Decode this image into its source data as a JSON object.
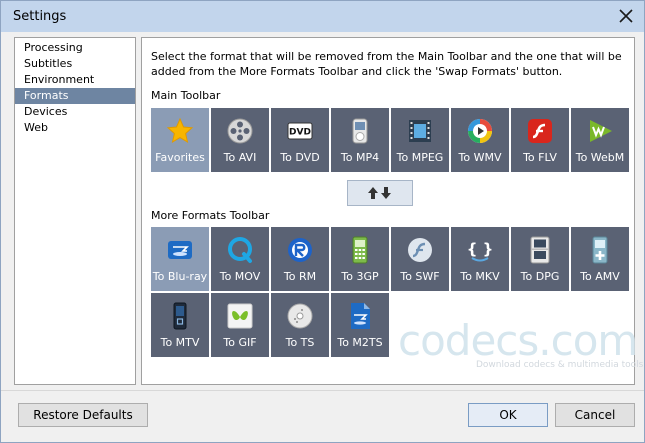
{
  "window": {
    "title": "Settings"
  },
  "sidebar": {
    "items": [
      {
        "label": "Processing"
      },
      {
        "label": "Subtitles"
      },
      {
        "label": "Environment"
      },
      {
        "label": "Formats",
        "selected": true
      },
      {
        "label": "Devices"
      },
      {
        "label": "Web"
      }
    ]
  },
  "content": {
    "description": "Select the format that will be removed from the Main Toolbar and the one that will be added from the More Formats Toolbar and click the 'Swap Formats' button.",
    "main_toolbar_label": "Main Toolbar",
    "more_toolbar_label": "More Formats Toolbar",
    "main_toolbar": [
      {
        "label": "Favorites",
        "icon": "star-icon",
        "selected": true
      },
      {
        "label": "To AVI",
        "icon": "film-reel-icon"
      },
      {
        "label": "To DVD",
        "icon": "dvd-icon"
      },
      {
        "label": "To MP4",
        "icon": "ipod-icon"
      },
      {
        "label": "To MPEG",
        "icon": "film-strip-icon"
      },
      {
        "label": "To WMV",
        "icon": "windows-media-icon"
      },
      {
        "label": "To FLV",
        "icon": "flash-icon"
      },
      {
        "label": "To WebM",
        "icon": "webm-icon"
      }
    ],
    "more_toolbar": [
      {
        "label": "To Blu-ray",
        "icon": "blu-ray-icon",
        "selected": true
      },
      {
        "label": "To MOV",
        "icon": "quicktime-icon"
      },
      {
        "label": "To RM",
        "icon": "realplayer-icon"
      },
      {
        "label": "To 3GP",
        "icon": "phone-icon"
      },
      {
        "label": "To SWF",
        "icon": "flash-swf-icon"
      },
      {
        "label": "To MKV",
        "icon": "matroska-icon"
      },
      {
        "label": "To DPG",
        "icon": "nintendo-ds-icon"
      },
      {
        "label": "To AMV",
        "icon": "amv-player-icon"
      },
      {
        "label": "To MTV",
        "icon": "mtv-player-icon"
      },
      {
        "label": "To GIF",
        "icon": "gif-icon"
      },
      {
        "label": "To TS",
        "icon": "ts-disc-icon"
      },
      {
        "label": "To M2TS",
        "icon": "m2ts-file-icon"
      }
    ],
    "swap_icon": "swap-arrows-icon",
    "watermark": {
      "brand": "codecs.com",
      "tagline": "Download codecs & multimedia tools"
    }
  },
  "footer": {
    "restore_label": "Restore Defaults",
    "ok_label": "OK",
    "cancel_label": "Cancel"
  },
  "colors": {
    "titlebar": "#c2d5ec",
    "tile": "#5a6274",
    "tile_selected": "#8b9cb5",
    "sidebar_selected": "#6e85a2"
  }
}
